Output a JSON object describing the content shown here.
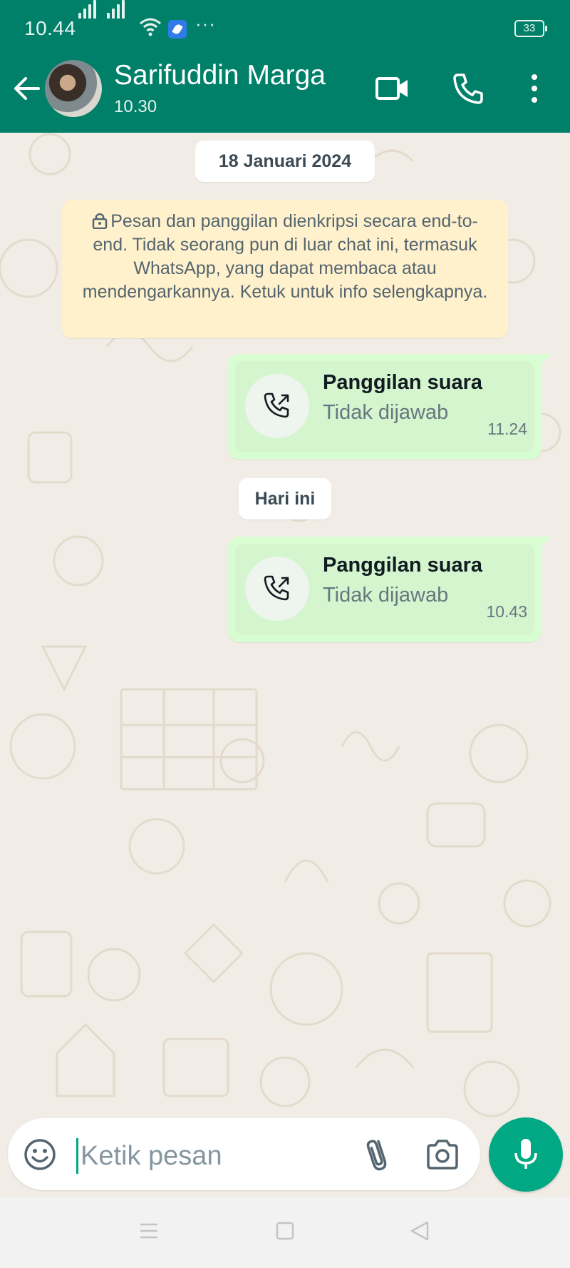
{
  "status_bar": {
    "time": "10.44",
    "more": "···",
    "battery": "33"
  },
  "header": {
    "contact_name": "Sarifuddin Marga",
    "contact_status": "10.30"
  },
  "chat": {
    "date_first": "18 Januari 2024",
    "encryption_notice": "Pesan dan panggilan dienkripsi secara end-to-end. Tidak seorang pun di luar chat ini, termasuk WhatsApp, yang dapat membaca atau mendengarkannya. Ketuk untuk info selengkapnya.",
    "date_today": "Hari ini",
    "messages": [
      {
        "title": "Panggilan suara",
        "subtitle": "Tidak dijawab",
        "time": "11.24"
      },
      {
        "title": "Panggilan suara",
        "subtitle": "Tidak dijawab",
        "time": "10.43"
      }
    ]
  },
  "composer": {
    "placeholder": "Ketik pesan"
  },
  "colors": {
    "header": "#008069",
    "accent": "#00a884",
    "outgoing_bubble": "#d9fdd3",
    "notice_bg": "#fff1cc",
    "chat_bg": "#efeae2"
  },
  "icons": [
    "back-arrow-icon",
    "video-call-icon",
    "phone-icon",
    "more-vertical-icon",
    "lock-icon",
    "outgoing-call-icon",
    "emoji-icon",
    "attach-icon",
    "camera-icon",
    "mic-icon",
    "menu-icon",
    "home-icon",
    "back-nav-icon"
  ]
}
